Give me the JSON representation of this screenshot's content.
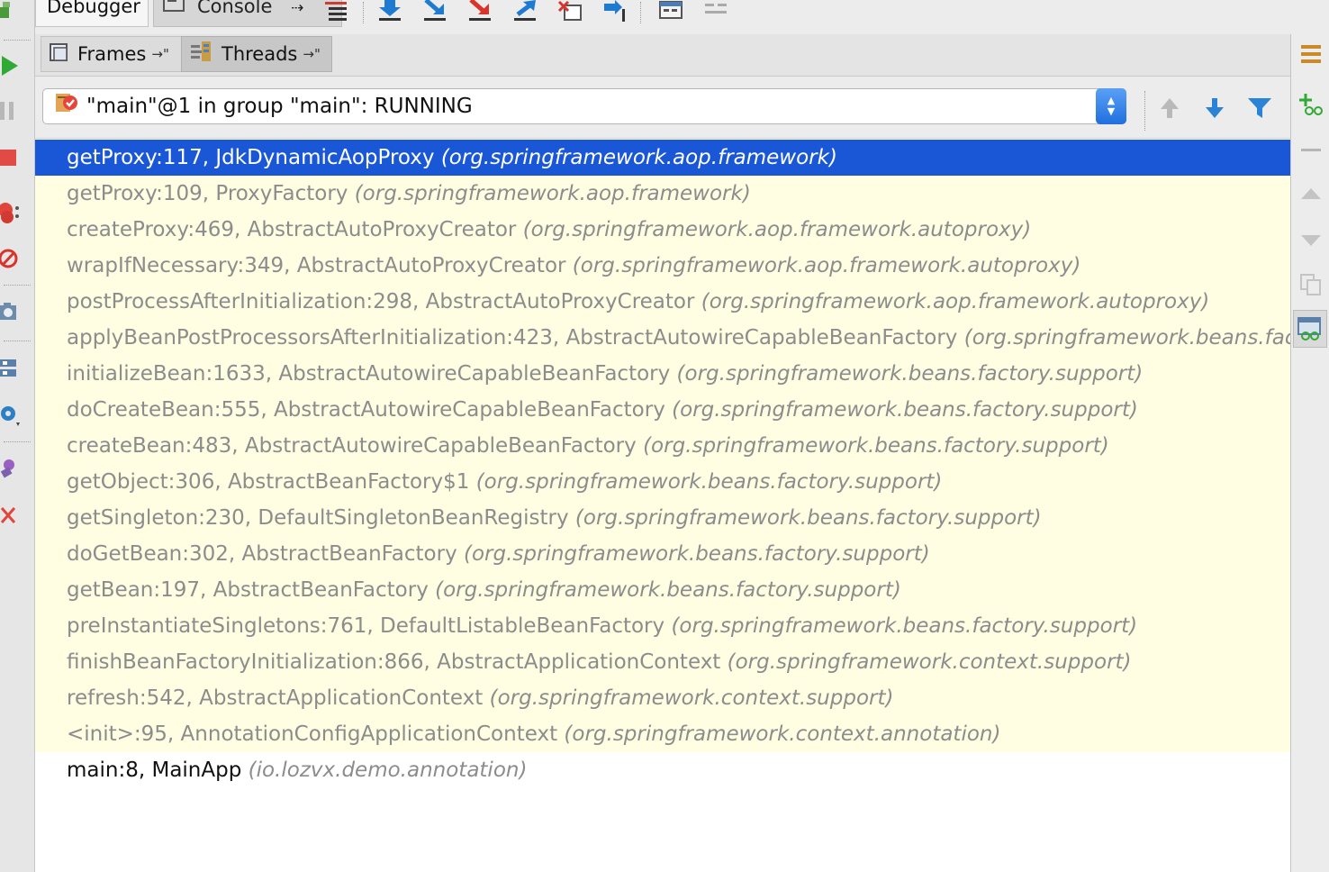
{
  "tabs": {
    "debugger_label": "Debugger",
    "console_label": "Console",
    "console_pin": "⇢"
  },
  "sub_tabs": {
    "frames_label": "Frames",
    "threads_label": "Threads",
    "pin_glyph": "→\""
  },
  "thread_selector": {
    "value": "\"main\"@1 in group \"main\": RUNNING"
  },
  "frames": [
    {
      "method": "getProxy:117, JdkDynamicAopProxy",
      "package": "(org.springframework.aop.framework)",
      "state": "selected"
    },
    {
      "method": "getProxy:109, ProxyFactory",
      "package": "(org.springframework.aop.framework)",
      "state": "library"
    },
    {
      "method": "createProxy:469, AbstractAutoProxyCreator",
      "package": "(org.springframework.aop.framework.autoproxy)",
      "state": "library"
    },
    {
      "method": "wrapIfNecessary:349, AbstractAutoProxyCreator",
      "package": "(org.springframework.aop.framework.autoproxy)",
      "state": "library"
    },
    {
      "method": "postProcessAfterInitialization:298, AbstractAutoProxyCreator",
      "package": "(org.springframework.aop.framework.autoproxy)",
      "state": "library"
    },
    {
      "method": "applyBeanPostProcessorsAfterInitialization:423, AbstractAutowireCapableBeanFactory",
      "package": "(org.springframework.beans.factory.support)",
      "state": "library"
    },
    {
      "method": "initializeBean:1633, AbstractAutowireCapableBeanFactory",
      "package": "(org.springframework.beans.factory.support)",
      "state": "library"
    },
    {
      "method": "doCreateBean:555, AbstractAutowireCapableBeanFactory",
      "package": "(org.springframework.beans.factory.support)",
      "state": "library"
    },
    {
      "method": "createBean:483, AbstractAutowireCapableBeanFactory",
      "package": "(org.springframework.beans.factory.support)",
      "state": "library"
    },
    {
      "method": "getObject:306, AbstractBeanFactory$1",
      "package": "(org.springframework.beans.factory.support)",
      "state": "library"
    },
    {
      "method": "getSingleton:230, DefaultSingletonBeanRegistry",
      "package": "(org.springframework.beans.factory.support)",
      "state": "library"
    },
    {
      "method": "doGetBean:302, AbstractBeanFactory",
      "package": "(org.springframework.beans.factory.support)",
      "state": "library"
    },
    {
      "method": "getBean:197, AbstractBeanFactory",
      "package": "(org.springframework.beans.factory.support)",
      "state": "library"
    },
    {
      "method": "preInstantiateSingletons:761, DefaultListableBeanFactory",
      "package": "(org.springframework.beans.factory.support)",
      "state": "library"
    },
    {
      "method": "finishBeanFactoryInitialization:866, AbstractApplicationContext",
      "package": "(org.springframework.context.support)",
      "state": "library"
    },
    {
      "method": "refresh:542, AbstractApplicationContext",
      "package": "(org.springframework.context.support)",
      "state": "library"
    },
    {
      "method": "<init>:95, AnnotationConfigApplicationContext",
      "package": "(org.springframework.context.annotation)",
      "state": "library"
    },
    {
      "method": "main:8, MainApp",
      "package": "(io.lozvx.demo.annotation)",
      "state": "normal"
    }
  ],
  "colors": {
    "selection": "#1a57d6",
    "library_background": "#fffee2",
    "library_text": "#8c8c8c"
  }
}
